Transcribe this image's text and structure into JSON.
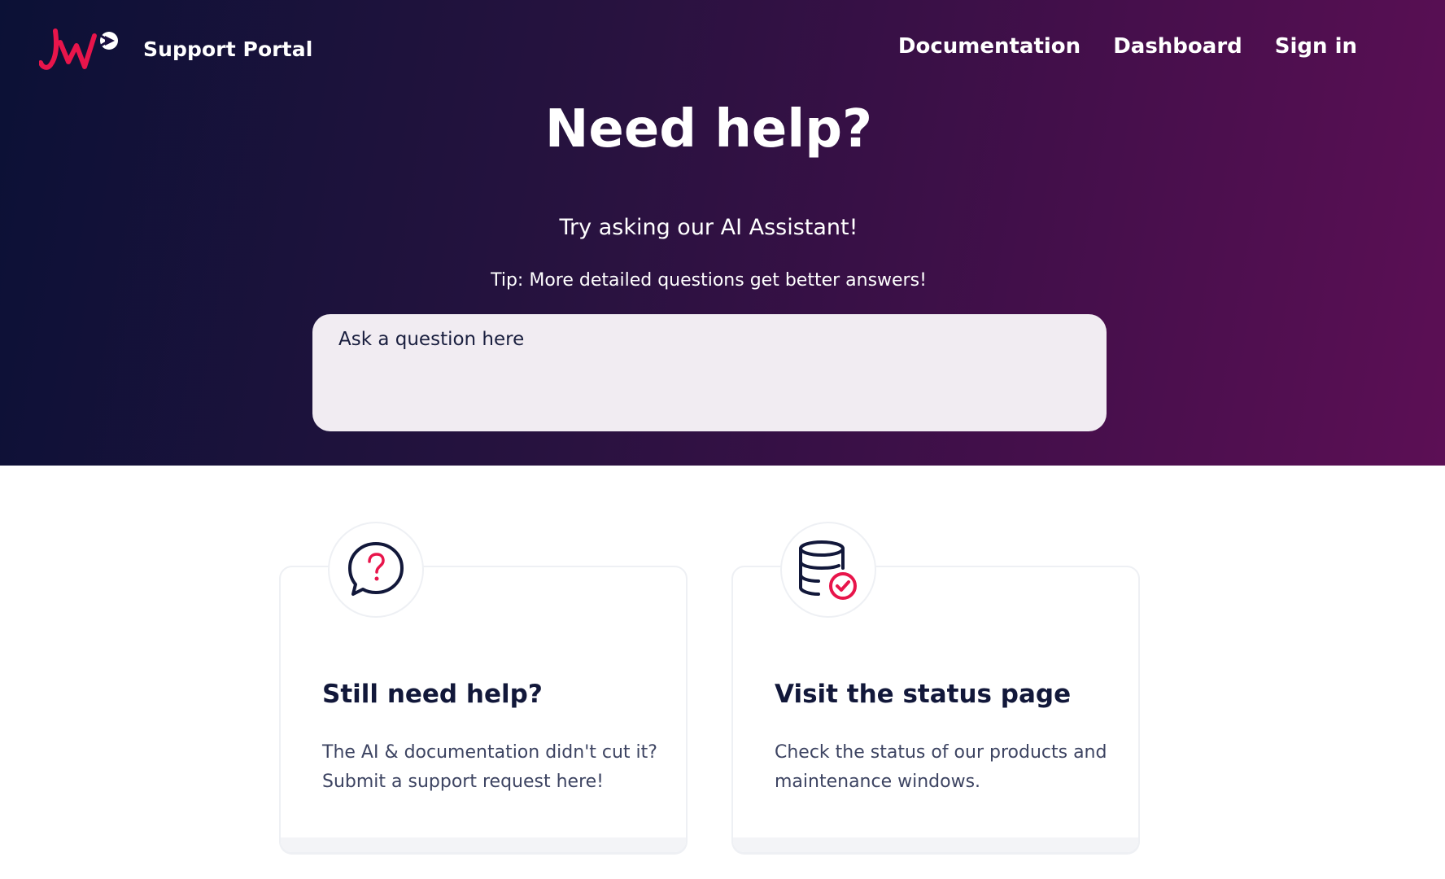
{
  "header": {
    "brand_title": "Support Portal",
    "logo_icon": "jw-logo",
    "nav": [
      {
        "label": "Documentation"
      },
      {
        "label": "Dashboard"
      },
      {
        "label": "Sign in"
      }
    ]
  },
  "hero": {
    "title": "Need help?",
    "subtitle": "Try asking our AI Assistant!",
    "tip": "Tip: More detailed questions get better answers!",
    "ask_placeholder": "Ask a question here"
  },
  "cards": [
    {
      "icon": "question-chat-icon",
      "title": "Still need help?",
      "text_line1": "The AI & documentation didn't cut it?",
      "text_line2": "Submit a support request here!"
    },
    {
      "icon": "database-check-icon",
      "title": "Visit the status page",
      "text_line1": "Check the status of our products and",
      "text_line2": "maintenance windows."
    }
  ],
  "colors": {
    "gradient_start": "#0b1136",
    "gradient_end": "#5c0f55",
    "accent": "#e8154b",
    "navy": "#12183a",
    "input_bg": "#f1ecf2"
  }
}
